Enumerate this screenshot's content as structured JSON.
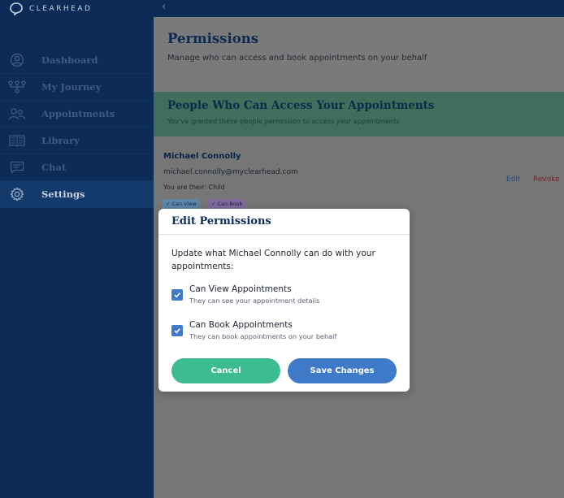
{
  "app": {
    "brand": "CLEARHEAD"
  },
  "sidebar": {
    "items": [
      {
        "label": "Dashboard",
        "icon": "user-circle-icon",
        "active": false
      },
      {
        "label": "My Journey",
        "icon": "journey-icon",
        "active": false
      },
      {
        "label": "Appointments",
        "icon": "users-icon",
        "active": false
      },
      {
        "label": "Library",
        "icon": "book-icon",
        "active": false
      },
      {
        "label": "Chat",
        "icon": "chat-icon",
        "active": false
      },
      {
        "label": "Settings",
        "icon": "gear-icon",
        "active": true
      }
    ]
  },
  "topbar": {
    "back_icon": "chevron-left-icon",
    "back_glyph": "‹"
  },
  "page": {
    "title": "Permissions",
    "subtitle": "Manage who can access and book appointments on your behalf"
  },
  "banner": {
    "title": "People Who Can Access Your Appointments",
    "subtitle": "You've granted these people permission to access your appointments"
  },
  "person": {
    "name": "Michael Connolly",
    "email": "michael.connolly@myclearhead.com",
    "relation": "You are their: Child",
    "tags": [
      "✓ Can View",
      "✓ Can Book"
    ],
    "edit_label": "Edit",
    "revoke_label": "Revoke"
  },
  "modal": {
    "title": "Edit Permissions",
    "description": "Update what Michael Connolly can do with your appointments:",
    "options": [
      {
        "label": "Can View Appointments",
        "hint": "They can see your appointment details",
        "checked": true
      },
      {
        "label": "Can Book Appointments",
        "hint": "They can book appointments on your behalf",
        "checked": true
      }
    ],
    "cancel_label": "Cancel",
    "save_label": "Save Changes"
  },
  "colors": {
    "sidebar_bg": "#0c2b57",
    "primary_blue": "#3f7ac8",
    "green": "#3dbb93",
    "revoke_red": "#c0392b"
  }
}
